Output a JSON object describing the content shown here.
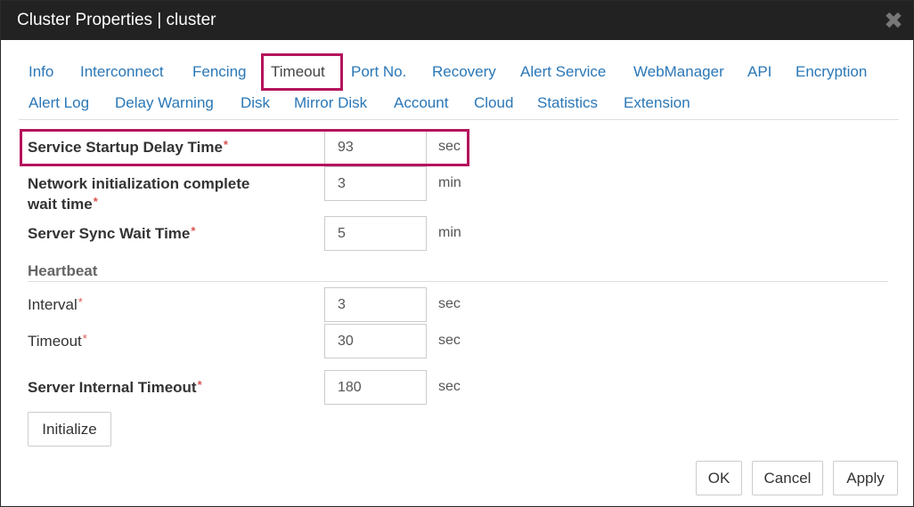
{
  "window": {
    "title": "Cluster Properties | cluster",
    "close_glyph": "✖"
  },
  "tabs": [
    {
      "label": "Info"
    },
    {
      "label": "Interconnect"
    },
    {
      "label": "Fencing"
    },
    {
      "label": "Timeout",
      "active": true
    },
    {
      "label": "Port No."
    },
    {
      "label": "Recovery"
    },
    {
      "label": "Alert Service"
    },
    {
      "label": "WebManager"
    },
    {
      "label": "API"
    },
    {
      "label": "Encryption"
    },
    {
      "label": "Alert Log"
    },
    {
      "label": "Delay Warning"
    },
    {
      "label": "Disk"
    },
    {
      "label": "Mirror Disk"
    },
    {
      "label": "Account"
    },
    {
      "label": "Cloud"
    },
    {
      "label": "Statistics"
    },
    {
      "label": "Extension"
    }
  ],
  "required_mark": "*",
  "fields": {
    "service_startup_delay": {
      "label": "Service Startup Delay Time",
      "value": "93",
      "unit": "sec"
    },
    "network_init_wait": {
      "label_line1": "Network initialization complete",
      "label_line2": "wait time",
      "value": "3",
      "unit": "min"
    },
    "server_sync_wait": {
      "label": "Server Sync Wait Time",
      "value": "5",
      "unit": "min"
    },
    "heartbeat": {
      "title": "Heartbeat",
      "interval": {
        "label": "Interval",
        "value": "3",
        "unit": "sec"
      },
      "timeout": {
        "label": "Timeout",
        "value": "30",
        "unit": "sec"
      }
    },
    "server_internal_timeout": {
      "label": "Server Internal Timeout",
      "value": "180",
      "unit": "sec"
    }
  },
  "buttons": {
    "initialize": "Initialize",
    "ok": "OK",
    "cancel": "Cancel",
    "apply": "Apply"
  },
  "colors": {
    "accent_link": "#2a77b7",
    "highlight": "#b5135d",
    "required": "#d9534f",
    "titlebar": "#222222"
  }
}
